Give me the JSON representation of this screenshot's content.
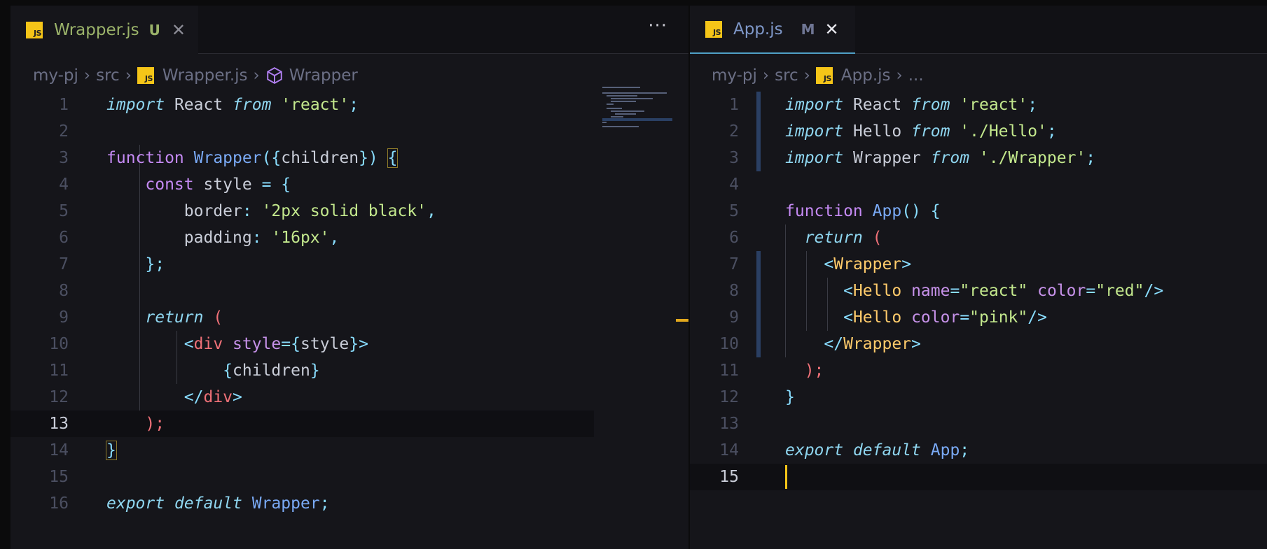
{
  "left_editor": {
    "tab": {
      "name": "Wrapper.js",
      "status": "U",
      "close": "✕"
    },
    "more": "···",
    "breadcrumb": {
      "project": "my-pj",
      "folder": "src",
      "file": "Wrapper.js",
      "symbol": "Wrapper"
    },
    "lines": [
      "1",
      "2",
      "3",
      "4",
      "5",
      "6",
      "7",
      "8",
      "9",
      "10",
      "11",
      "12",
      "13",
      "14",
      "15",
      "16"
    ],
    "code": {
      "l1": {
        "a": "import",
        "b": " React ",
        "c": "from",
        "d": " ",
        "e": "'react'",
        "f": ";"
      },
      "l3": {
        "a": "function",
        "b": " ",
        "c": "Wrapper",
        "d": "({",
        "e": "children",
        "f": "})",
        "g": " ",
        "h": "{"
      },
      "l4": {
        "a": "const",
        "b": " style ",
        "c": "=",
        "d": " ",
        "e": "{"
      },
      "l5": {
        "a": "border",
        "b": ": ",
        "c": "'2px solid black'",
        "d": ","
      },
      "l6": {
        "a": "padding",
        "b": ": ",
        "c": "'16px'",
        "d": ","
      },
      "l7": {
        "a": "};"
      },
      "l9": {
        "a": "return",
        "b": " ",
        "c": "("
      },
      "l10": {
        "a": "<",
        "b": "div",
        "c": " ",
        "d": "style",
        "e": "={",
        "f": "style",
        "g": "}>"
      },
      "l11": {
        "a": "{",
        "b": "children",
        "c": "}"
      },
      "l12": {
        "a": "</",
        "b": "div",
        "c": ">"
      },
      "l13": {
        "a": ");"
      },
      "l14": {
        "a": "}"
      },
      "l16": {
        "a": "export",
        "b": " ",
        "c": "default",
        "d": " ",
        "e": "Wrapper",
        "f": ";"
      }
    }
  },
  "right_editor": {
    "tab": {
      "name": "App.js",
      "status": "M",
      "close": "✕"
    },
    "breadcrumb": {
      "project": "my-pj",
      "folder": "src",
      "file": "App.js",
      "symbol": "..."
    },
    "lines": [
      "1",
      "2",
      "3",
      "4",
      "5",
      "6",
      "7",
      "8",
      "9",
      "10",
      "11",
      "12",
      "13",
      "14",
      "15"
    ],
    "code": {
      "l1": {
        "a": "import",
        "b": " React ",
        "c": "from",
        "d": " ",
        "e": "'react'",
        "f": ";"
      },
      "l2": {
        "a": "import",
        "b": " Hello ",
        "c": "from",
        "d": " ",
        "e": "'./Hello'",
        "f": ";"
      },
      "l3": {
        "a": "import",
        "b": " Wrapper ",
        "c": "from",
        "d": " ",
        "e": "'./Wrapper'",
        "f": ";"
      },
      "l5": {
        "a": "function",
        "b": " ",
        "c": "App",
        "d": "() {"
      },
      "l6": {
        "a": "return",
        "b": " ",
        "c": "("
      },
      "l7": {
        "a": "<",
        "b": "Wrapper",
        "c": ">"
      },
      "l8": {
        "a": "<",
        "b": "Hello",
        "c": " ",
        "d": "name",
        "e": "=",
        "f": "\"react\"",
        "g": " ",
        "h": "color",
        "i": "=",
        "j": "\"red\"",
        "k": "/>"
      },
      "l9": {
        "a": "<",
        "b": "Hello",
        "c": " ",
        "d": "color",
        "e": "=",
        "f": "\"pink\"",
        "g": "/>"
      },
      "l10": {
        "a": "</",
        "b": "Wrapper",
        "c": ">"
      },
      "l11": {
        "a": ");"
      },
      "l12": {
        "a": "}"
      },
      "l14": {
        "a": "export",
        "b": " ",
        "c": "default",
        "d": " ",
        "e": "App",
        "f": ";"
      }
    }
  },
  "colors": {
    "accent": "#f5c518",
    "tab_underline": "#4fa0c6",
    "git_modified": "#2a3f63"
  },
  "icons": {
    "js": "js-file-icon",
    "symbol": "cube-icon",
    "more": "ellipsis-icon"
  }
}
